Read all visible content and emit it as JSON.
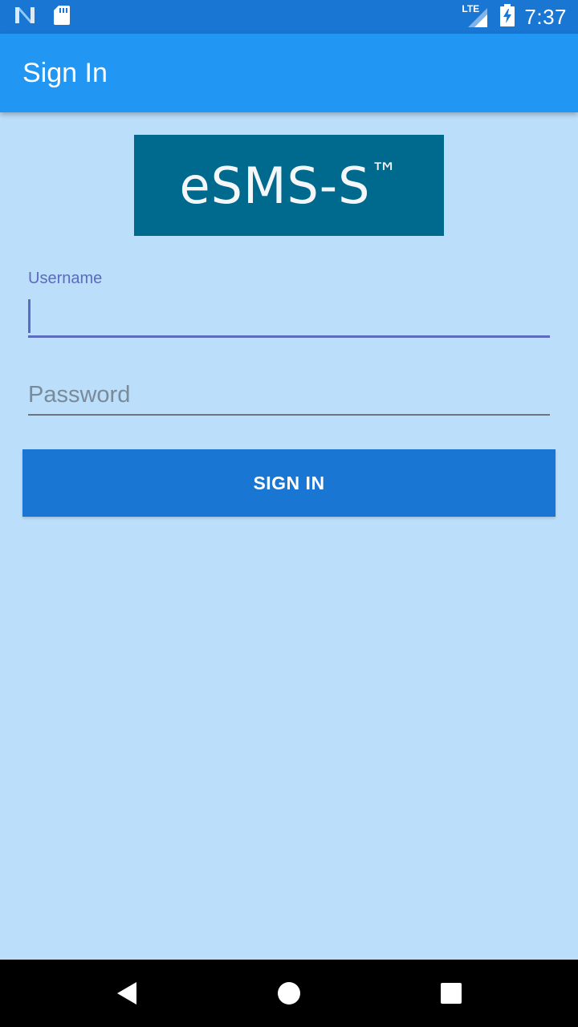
{
  "status_bar": {
    "time": "7:37",
    "network": "LTE",
    "icons": [
      "notification-n-icon",
      "sd-card-icon",
      "lte-signal-icon",
      "battery-charging-icon"
    ]
  },
  "app_bar": {
    "title": "Sign In"
  },
  "logo": {
    "text": "eSMS-S",
    "mark": "™"
  },
  "form": {
    "username": {
      "label": "Username",
      "value": ""
    },
    "password": {
      "placeholder": "Password",
      "value": ""
    },
    "submit_label": "SIGN IN"
  },
  "nav_bar": {
    "icons": [
      "back-icon",
      "home-icon",
      "recents-icon"
    ]
  },
  "colors": {
    "status_bar": "#1976d2",
    "app_bar": "#2196f3",
    "background": "#bbdefb",
    "logo_bg": "#006a8e",
    "accent": "#5c6bc0",
    "button": "#1976d2"
  }
}
